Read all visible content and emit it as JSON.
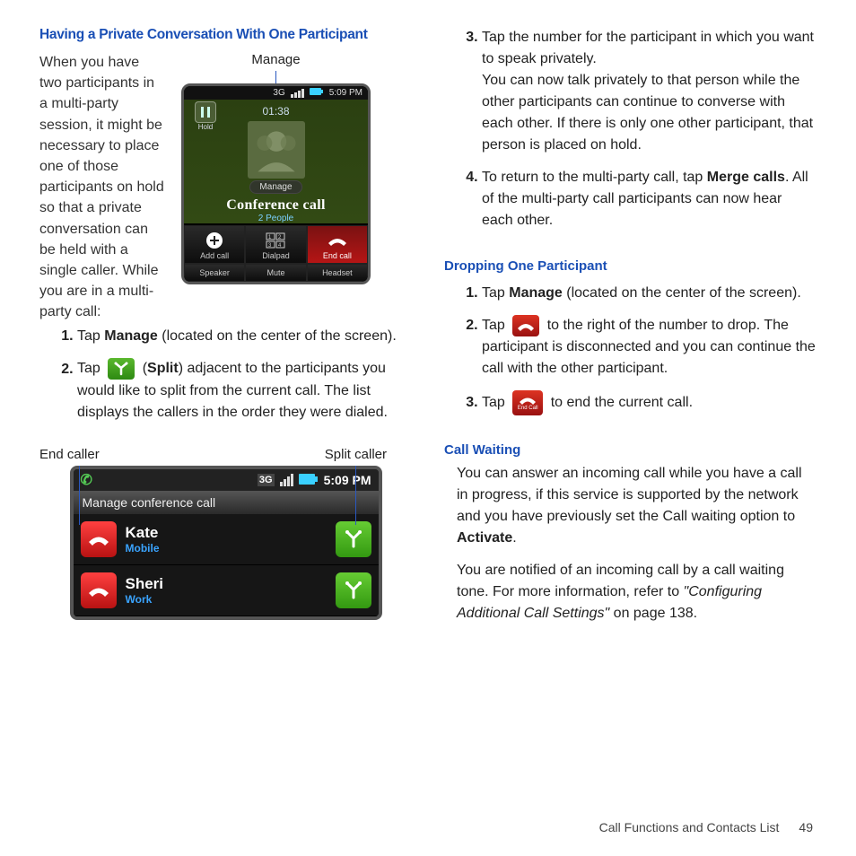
{
  "left": {
    "title": "Having a Private Conversation With One Participant",
    "intro": "When you have two participants in a multi-party session, it might be necessary to place one of those participants on hold so that a private conversation can be held with a single caller. While you are in a multi-party call:",
    "phone1_label": "Manage",
    "phone1": {
      "time": "5:09 PM",
      "hold": "Hold",
      "timer": "01:38",
      "manage": "Manage",
      "conf": "Conference call",
      "people": "2 People",
      "btns": {
        "add": "Add call",
        "dial": "Dialpad",
        "end": "End call",
        "spk": "Speaker",
        "mute": "Mute",
        "head": "Headset"
      }
    },
    "step1": {
      "a": "Tap ",
      "b": "Manage",
      "c": " (located on the center of the screen)."
    },
    "step2": {
      "a": "Tap ",
      "b": " (",
      "c": "Split",
      "d": ") adjacent to the participants you would like to split from the current call. The list displays the callers in the order they were dialed."
    },
    "labels2": {
      "end": "End caller",
      "split": "Split caller"
    },
    "phone2": {
      "time": "5:09 PM",
      "title": "Manage conference call",
      "c1": {
        "name": "Kate",
        "type": "Mobile"
      },
      "c2": {
        "name": "Sheri",
        "type": "Work"
      }
    }
  },
  "right": {
    "step3": {
      "a": "Tap the number for the participant in which you want to speak privately.",
      "b": "You can now talk privately to that person while the other participants can continue to converse with each other. If there is only one other participant, that person is placed on hold."
    },
    "step4": {
      "a": "To return to the multi-party call, tap ",
      "b": "Merge calls",
      "c": ". All of the multi-party call participants can now hear each other."
    },
    "drop": {
      "title": "Dropping One Participant",
      "s1": {
        "a": "Tap ",
        "b": "Manage",
        "c": " (located on the center of the screen)."
      },
      "s2": {
        "a": "Tap ",
        "b": " to the right of the number to drop. The participant is disconnected and you can continue the call with the other participant."
      },
      "s3": {
        "a": "Tap ",
        "b": " to end the current call."
      }
    },
    "cw": {
      "title": "Call Waiting",
      "p1": {
        "a": "You can answer an incoming call while you have a call in progress, if this service is supported by the network and you have previously set the Call waiting option to ",
        "b": "Activate",
        "c": "."
      },
      "p2": {
        "a": "You are notified of an incoming call by a call waiting tone. For more information, refer to ",
        "b": "\"Configuring Additional Call Settings\"",
        "c": "  on page 138."
      }
    }
  },
  "footer": {
    "chapter": "Call Functions and Contacts List",
    "page": "49"
  }
}
